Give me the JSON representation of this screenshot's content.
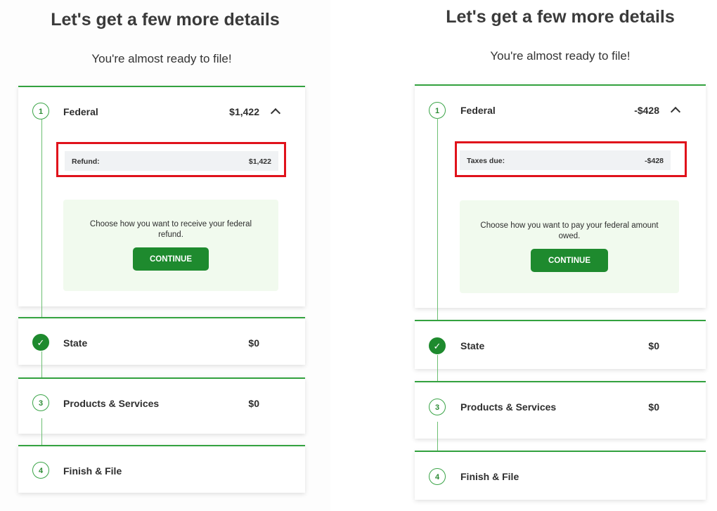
{
  "panels": [
    {
      "title": "Let's get a few more details",
      "subtitle": "You're almost ready to file!",
      "steps": [
        {
          "number": "1",
          "label": "Federal",
          "amount": "$1,422",
          "state": "expanded"
        },
        {
          "number": "✓",
          "label": "State",
          "amount": "$0",
          "state": "complete"
        },
        {
          "number": "3",
          "label": "Products & Services",
          "amount": "$0",
          "state": "pending"
        },
        {
          "number": "4",
          "label": "Finish & File",
          "amount": "",
          "state": "pending"
        }
      ],
      "summary": {
        "label": "Refund:",
        "value": "$1,422"
      },
      "prompt": "Choose how you want to receive your federal refund.",
      "button": "CONTINUE"
    },
    {
      "title": "Let's get a few more details",
      "subtitle": "You're almost ready to file!",
      "steps": [
        {
          "number": "1",
          "label": "Federal",
          "amount": "-$428",
          "state": "expanded"
        },
        {
          "number": "✓",
          "label": "State",
          "amount": "$0",
          "state": "complete"
        },
        {
          "number": "3",
          "label": "Products & Services",
          "amount": "$0",
          "state": "pending"
        },
        {
          "number": "4",
          "label": "Finish & File",
          "amount": "",
          "state": "pending"
        }
      ],
      "summary": {
        "label": "Taxes due:",
        "value": "-$428"
      },
      "prompt": "Choose how you want to pay your federal amount owed.",
      "button": "CONTINUE"
    }
  ],
  "colors": {
    "accent": "#1e8a2e",
    "highlight": "#e0121b",
    "step_border": "#33a23f"
  },
  "icons": {
    "collapse": "chevron-up-icon",
    "complete": "checkmark-icon"
  }
}
